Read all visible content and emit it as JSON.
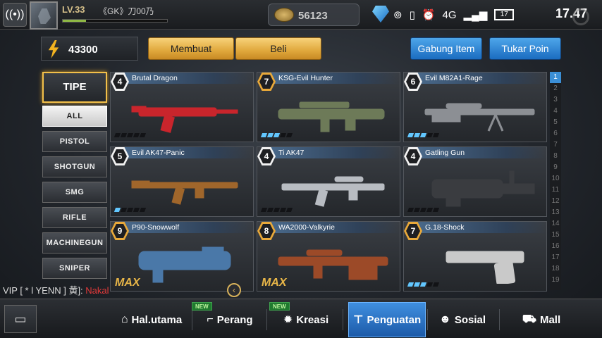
{
  "status": {
    "level": "LV.33",
    "username": "《GK》刀00乃",
    "xp_fraction": 0.22,
    "coins": "56123",
    "time": "17.47",
    "network": "4G",
    "battery": "17"
  },
  "currency": {
    "power": "43300"
  },
  "buttons": {
    "membuat": "Membuat",
    "beli": "Beli",
    "gabung_item": "Gabung Item",
    "tukar_poin": "Tukar Poin"
  },
  "filters": {
    "tipe": "TIPE",
    "items": [
      "ALL",
      "PISTOL",
      "SHOTGUN",
      "SMG",
      "RIFLE",
      "MACHINEGUN",
      "SNIPER"
    ],
    "active_index": 0
  },
  "weapons": [
    {
      "name": "Brutal Dragon",
      "level": "4",
      "badge": "silver",
      "max": "",
      "dots_on": 0,
      "color": "#c9252c"
    },
    {
      "name": "KSG-Evil Hunter",
      "level": "7",
      "badge": "gold",
      "max": "",
      "dots_on": 3,
      "color": "#6d7a58"
    },
    {
      "name": "Evil M82A1-Rage",
      "level": "6",
      "badge": "silver",
      "max": "",
      "dots_on": 3,
      "color": "#8c8f94"
    },
    {
      "name": "Evil AK47-Panic",
      "level": "5",
      "badge": "silver",
      "max": "",
      "dots_on": 1,
      "color": "#a0662b"
    },
    {
      "name": "Ti AK47",
      "level": "4",
      "badge": "silver",
      "max": "",
      "dots_on": 0,
      "color": "#b8bcc2"
    },
    {
      "name": "Gatling Gun",
      "level": "4",
      "badge": "silver",
      "max": "",
      "dots_on": 0,
      "color": "#3a3c40"
    },
    {
      "name": "P90-Snowwolf",
      "level": "9",
      "badge": "gold",
      "max": "MAX",
      "dots_on": 0,
      "color": "#4a78a8"
    },
    {
      "name": "WA2000-Valkyrie",
      "level": "8",
      "badge": "gold",
      "max": "MAX",
      "dots_on": 0,
      "color": "#9c4a28"
    },
    {
      "name": "G.18-Shock",
      "level": "7",
      "badge": "gold",
      "max": "",
      "dots_on": 3,
      "color": "#c9c9c9"
    }
  ],
  "pager": {
    "pages": [
      "1",
      "2",
      "3",
      "4",
      "5",
      "6",
      "7",
      "8",
      "9",
      "10",
      "11",
      "12",
      "13",
      "14",
      "15",
      "16",
      "17",
      "18",
      "19"
    ],
    "active": 0
  },
  "chat": {
    "prefix": "VIP [ * l YENN ] 黄]: ",
    "message": "Nakal"
  },
  "nav": {
    "items": [
      {
        "label": "Hal.utama",
        "icon": "⌂",
        "new": ""
      },
      {
        "label": "Perang",
        "icon": "⌐",
        "new": "NEW"
      },
      {
        "label": "Kreasi",
        "icon": "✹",
        "new": "NEW"
      },
      {
        "label": "Penguatan",
        "icon": "⊤",
        "new": ""
      },
      {
        "label": "Sosial",
        "icon": "☻",
        "new": ""
      },
      {
        "label": "Mall",
        "icon": "⛟",
        "new": ""
      }
    ],
    "active_index": 3
  }
}
